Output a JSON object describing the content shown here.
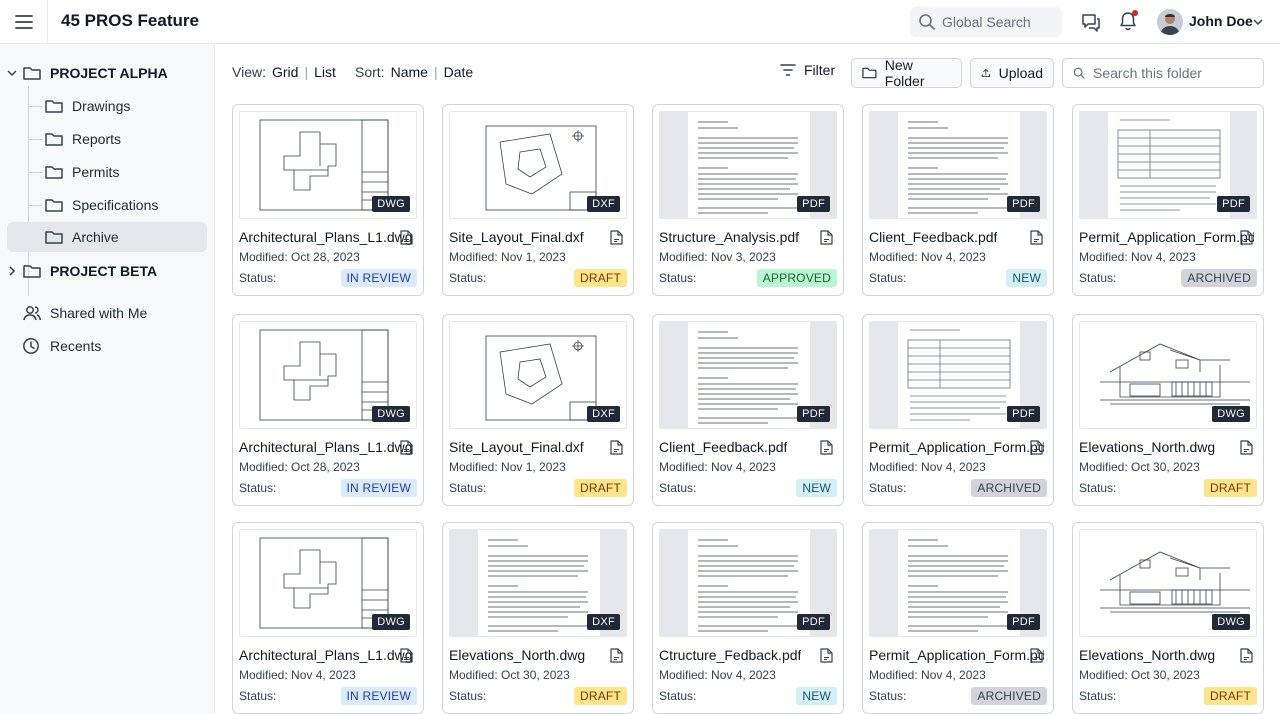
{
  "header": {
    "app_title": "45 PROS Feature",
    "global_search_placeholder": "Global Search",
    "user_name": "John Doe"
  },
  "sidebar": {
    "projects": [
      {
        "label": "PROJECT ALPHA",
        "expanded": true
      },
      {
        "label": "PROJECT BETA",
        "expanded": false
      }
    ],
    "folders": [
      "Drawings",
      "Reports",
      "Permits",
      "Specifications",
      "Archive"
    ],
    "selected_folder": "Archive",
    "links": [
      "Shared with Me",
      "Recents"
    ]
  },
  "toolbar": {
    "view_label": "View:",
    "view_grid": "Grid",
    "view_list": "List",
    "sort_label": "Sort:",
    "sort_name": "Name",
    "sort_date": "Date",
    "filter_label": "Filter",
    "new_folder_label": "New Folder",
    "upload_label": "Upload",
    "folder_search_placeholder": "Search this folder"
  },
  "status_label": "Status:",
  "files": [
    {
      "name": "Architectural_Plans_L1.dwg",
      "modified": "Modified: Oct 28, 2023",
      "type": "DWG",
      "status": "IN REVIEW",
      "thumb": "plan"
    },
    {
      "name": "Site_Layout_Final.dxf",
      "modified": "Modified: Nov 1, 2023",
      "type": "DXF",
      "status": "DRAFT",
      "thumb": "site"
    },
    {
      "name": "Structure_Analysis.pdf",
      "modified": "Modified: Nov 3, 2023",
      "type": "PDF",
      "status": "APPROVED",
      "thumb": "doc"
    },
    {
      "name": "Client_Feedback.pdf",
      "modified": "Modified: Nov 4, 2023",
      "type": "PDF",
      "status": "NEW",
      "thumb": "doc"
    },
    {
      "name": "Permit_Application_Form.pdf",
      "modified": "Modified: Nov 4, 2023",
      "type": "PDF",
      "status": "ARCHIVED",
      "thumb": "form"
    },
    {
      "name": "Architectural_Plans_L1.dwg",
      "modified": "Modified: Oct 28, 2023",
      "type": "DWG",
      "status": "IN REVIEW",
      "thumb": "plan"
    },
    {
      "name": "Site_Layout_Final.dxf",
      "modified": "Modified: Nov 1, 2023",
      "type": "DXF",
      "status": "DRAFT",
      "thumb": "site"
    },
    {
      "name": "Client_Feedback.pdf",
      "modified": "Modified: Nov 4, 2023",
      "type": "PDF",
      "status": "NEW",
      "thumb": "doc"
    },
    {
      "name": "Permit_Application_Form.pdf",
      "modified": "Modified: Nov 4, 2023",
      "type": "PDF",
      "status": "ARCHIVED",
      "thumb": "form"
    },
    {
      "name": "Elevations_North.dwg",
      "modified": "Modified: Oct 30, 2023",
      "type": "DWG",
      "status": "DRAFT",
      "thumb": "elev"
    },
    {
      "name": "Architectural_Plans_L1.dwg",
      "modified": "Modified: Nov 4, 2023",
      "type": "DWG",
      "status": "IN REVIEW",
      "thumb": "plan"
    },
    {
      "name": "Elevations_North.dwg",
      "modified": "Modified: Oct 30, 2023",
      "type": "DXF",
      "status": "DRAFT",
      "thumb": "doc"
    },
    {
      "name": "Ctructure_Fedback.pdf",
      "modified": "Modified: Nov 4, 2023",
      "type": "PDF",
      "status": "NEW",
      "thumb": "doc"
    },
    {
      "name": "Permit_Application_Form.pdf",
      "modified": "Modified: Nov 4, 2023",
      "type": "PDF",
      "status": "ARCHIVED",
      "thumb": "doc"
    },
    {
      "name": "Elevations_North.dwg",
      "modified": "Modified: Oct 30, 2023",
      "type": "DWG",
      "status": "DRAFT",
      "thumb": "elev"
    }
  ],
  "colors": {
    "in_review": "#dbeafe",
    "draft": "#fde68a",
    "approved": "#bbf7d0",
    "new": "#d4f0f4",
    "archived": "#d1d5db",
    "type_badge": "#1f2937"
  },
  "icons": [
    "hamburger-icon",
    "search-icon",
    "chat-icon",
    "bell-icon",
    "chevron-down-icon",
    "folder-icon",
    "users-icon",
    "clock-icon",
    "filter-icon",
    "upload-icon",
    "file-icon"
  ]
}
